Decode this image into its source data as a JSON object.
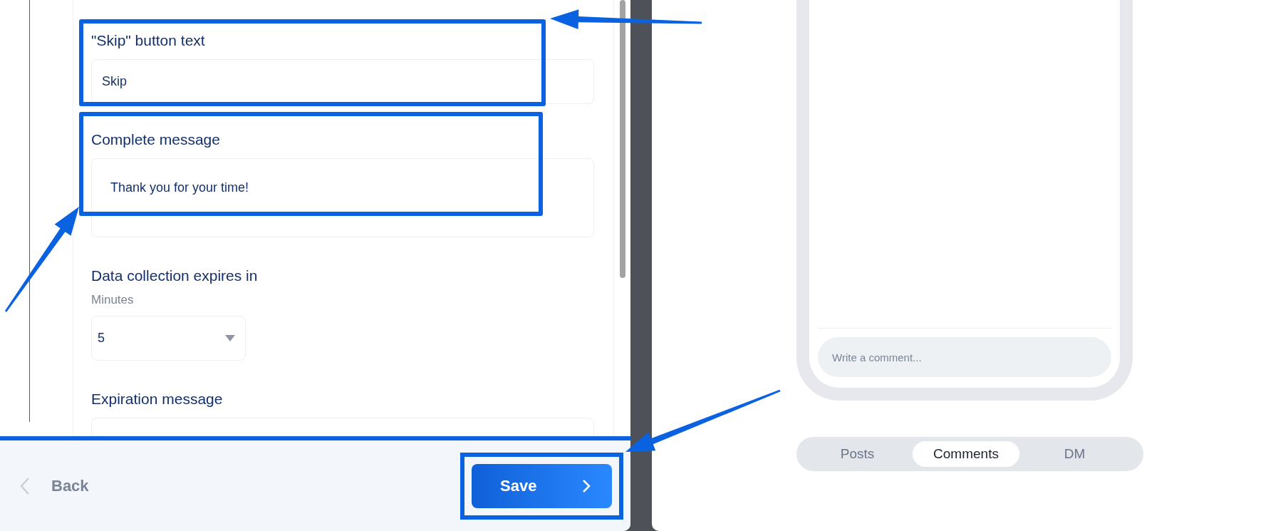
{
  "form": {
    "fields": [
      {
        "kind": "input",
        "label": "\"Skip\" button text",
        "value": "Skip"
      },
      {
        "kind": "textarea",
        "label": "Complete message",
        "value": "Thank you for your time!"
      },
      {
        "kind": "select",
        "label": "Data collection expires in",
        "sublabel": "Minutes",
        "value": "5"
      },
      {
        "kind": "textarea",
        "label": "Expiration message"
      }
    ]
  },
  "footer": {
    "back": {
      "label": "Back",
      "disabled": true
    },
    "save": {
      "label": "Save"
    }
  },
  "preview": {
    "comment_placeholder": "Write a comment...",
    "tabs": [
      {
        "label": "Posts",
        "selected": false
      },
      {
        "label": "Comments",
        "selected": true
      },
      {
        "label": "DM",
        "selected": false
      }
    ]
  }
}
